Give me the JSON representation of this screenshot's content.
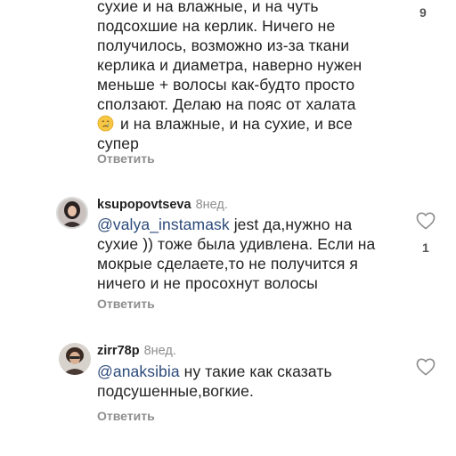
{
  "comment1": {
    "line1": "сухие и на влажные, и на чуть",
    "line2": "подсохшие на керлик. Ничего не",
    "line3": "получилось, возможно из-за ткани",
    "line4": "керлика и диаметра, наверно нужен",
    "line5": "меньше + волосы как-будто просто",
    "line6": "сползают. Делаю на пояс от халата",
    "line7": " и на влажные, и на сухие, и все",
    "line8": "супер",
    "emoji": "crying-face-icon",
    "likes": "9",
    "reply_label": "Ответить"
  },
  "comment2": {
    "username": "ksupopovtseva",
    "time": "8нед.",
    "mention": "@valya_instamask",
    "line1_rest": " jest да,нужно на",
    "line2": "сухие )) тоже была удивлена. Если на",
    "line3": "мокрые сделаете,то не получится я",
    "line4": "ничего и не просохнут волосы",
    "likes": "1",
    "reply_label": "Ответить"
  },
  "comment3": {
    "username": "zirr78p",
    "time": "8нед.",
    "mention": "@anaksibia",
    "line1_rest": " ну такие как сказать",
    "line2": "подсушенные,вогкие.",
    "reply_label": "Ответить"
  },
  "colors": {
    "mention": "#2b4a7a",
    "muted": "#8e8e8e"
  }
}
